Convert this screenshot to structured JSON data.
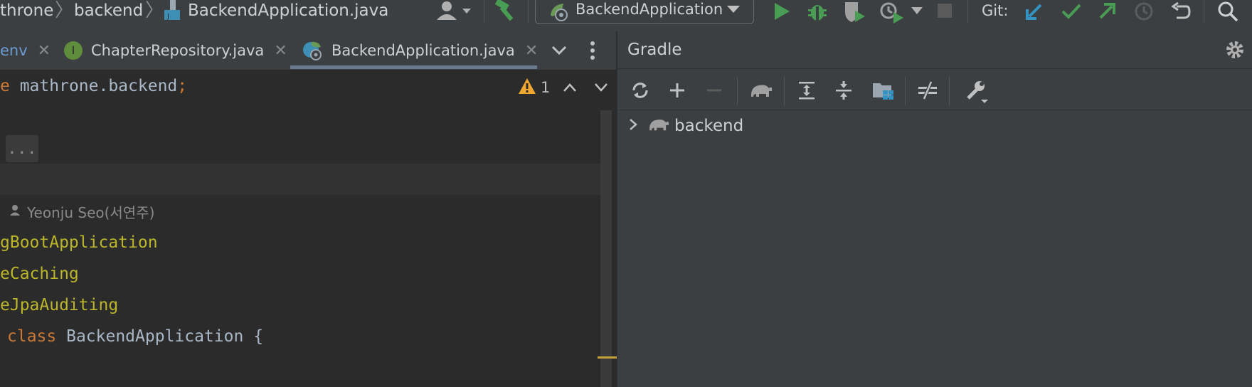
{
  "breadcrumb": {
    "items": [
      "throne",
      "backend",
      "BackendApplication.java"
    ]
  },
  "run_config": {
    "label": "BackendApplication"
  },
  "git": {
    "label": "Git:"
  },
  "tabs": [
    {
      "label": "env",
      "active": false
    },
    {
      "label": "ChapterRepository.java",
      "active": false
    },
    {
      "label": "BackendApplication.java",
      "active": true
    }
  ],
  "editor": {
    "inspection": {
      "warning_count": "1"
    },
    "lines": {
      "package_kw": "e",
      "package_name": " mathrone.backend",
      "package_semicolon": ";",
      "fold_placeholder": "...",
      "author": "Yeonju Seo(서연주)",
      "ann1": "gBootApplication",
      "ann2": "eCaching",
      "ann3": "eJpaAuditing",
      "class_kw": "class",
      "class_name": " BackendApplication ",
      "class_brace": "{"
    }
  },
  "gradle": {
    "title": "Gradle",
    "tree": [
      {
        "label": "backend"
      }
    ]
  },
  "colors": {
    "run_green": "#499c54",
    "git_blue": "#3592c4",
    "keyword_orange": "#cc7832",
    "annotation_yellow": "#bbb529",
    "warning_yellow": "#f0a732"
  }
}
